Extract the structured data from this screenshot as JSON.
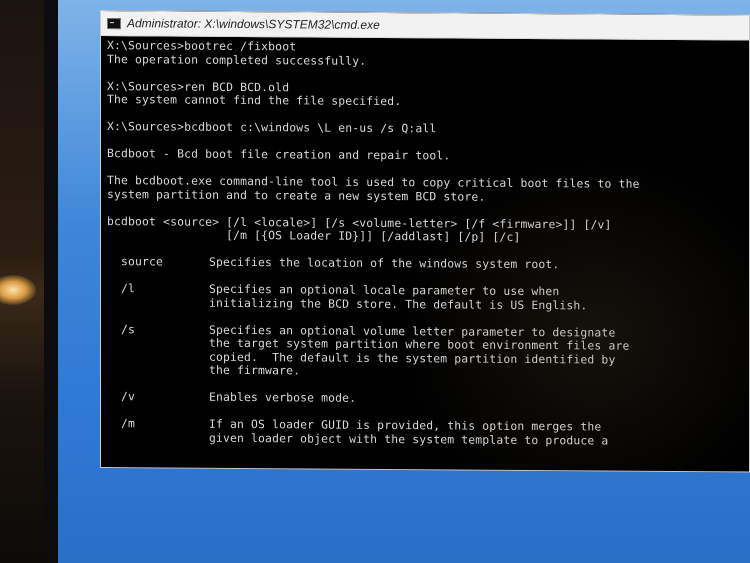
{
  "window": {
    "title": "Administrator: X:\\windows\\SYSTEM32\\cmd.exe"
  },
  "console": {
    "blocks": [
      [
        "X:\\Sources>bootrec /fixboot",
        "The operation completed successfully."
      ],
      [
        "X:\\Sources>ren BCD BCD.old",
        "The system cannot find the file specified."
      ],
      [
        "X:\\Sources>bcdboot c:\\windows \\L en-us /s Q:all"
      ],
      [
        "Bcdboot - Bcd boot file creation and repair tool."
      ],
      [
        "The bcdboot.exe command-line tool is used to copy critical boot files to the",
        "system partition and to create a new system BCD store."
      ],
      [
        "bcdboot <source> [/l <locale>] [/s <volume-letter> [/f <firmware>]] [/v]",
        "                 [/m [{OS Loader ID}]] [/addlast] [/p] [/c]"
      ]
    ],
    "options": [
      {
        "name": "source",
        "lines": [
          "Specifies the location of the windows system root."
        ]
      },
      {
        "name": "/l",
        "lines": [
          "Specifies an optional locale parameter to use when",
          "initializing the BCD store. The default is US English."
        ]
      },
      {
        "name": "/s",
        "lines": [
          "Specifies an optional volume letter parameter to designate",
          "the target system partition where boot environment files are",
          "copied.  The default is the system partition identified by",
          "the firmware."
        ]
      },
      {
        "name": "/v",
        "lines": [
          "Enables verbose mode."
        ]
      },
      {
        "name": "/m",
        "lines": [
          "If an OS loader GUID is provided, this option merges the",
          "given loader object with the system template to produce a"
        ]
      }
    ]
  }
}
